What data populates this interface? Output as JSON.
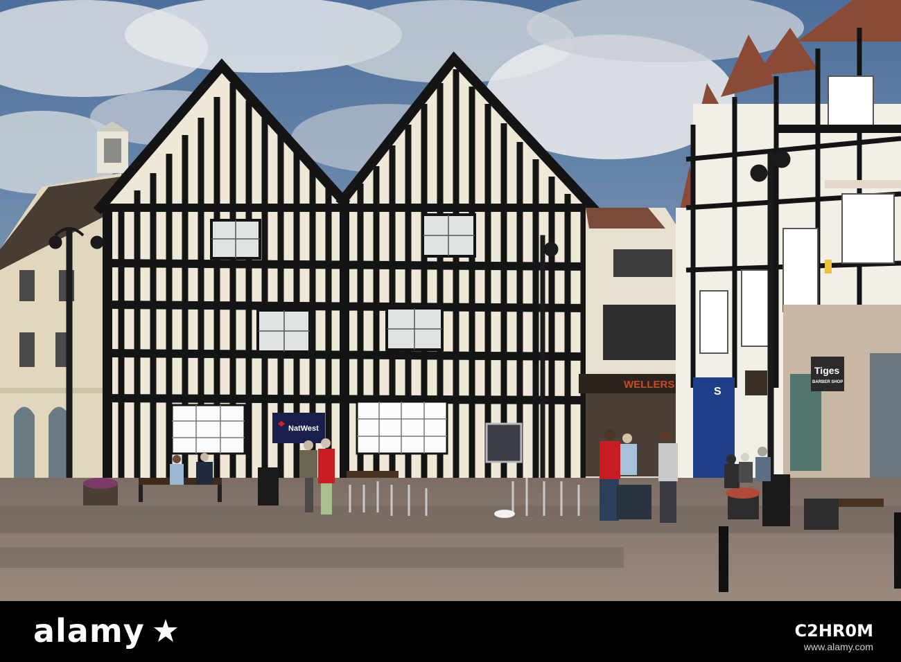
{
  "scene": {
    "signs": {
      "bank": "NatWest",
      "jewellers": "WELLERS",
      "shop_s": "S",
      "barber": "Tiges",
      "barber_sub": "BARBER SHOP"
    }
  },
  "watermark": {
    "brand": "alamy",
    "stock_id": "C2HR0M",
    "site": "www.alamy.com"
  },
  "colors": {
    "sky": "#5d7fa8",
    "timber": "#141414",
    "plaster": "#efe8d6",
    "pavement": "#8f7f74",
    "footer": "#000000"
  }
}
